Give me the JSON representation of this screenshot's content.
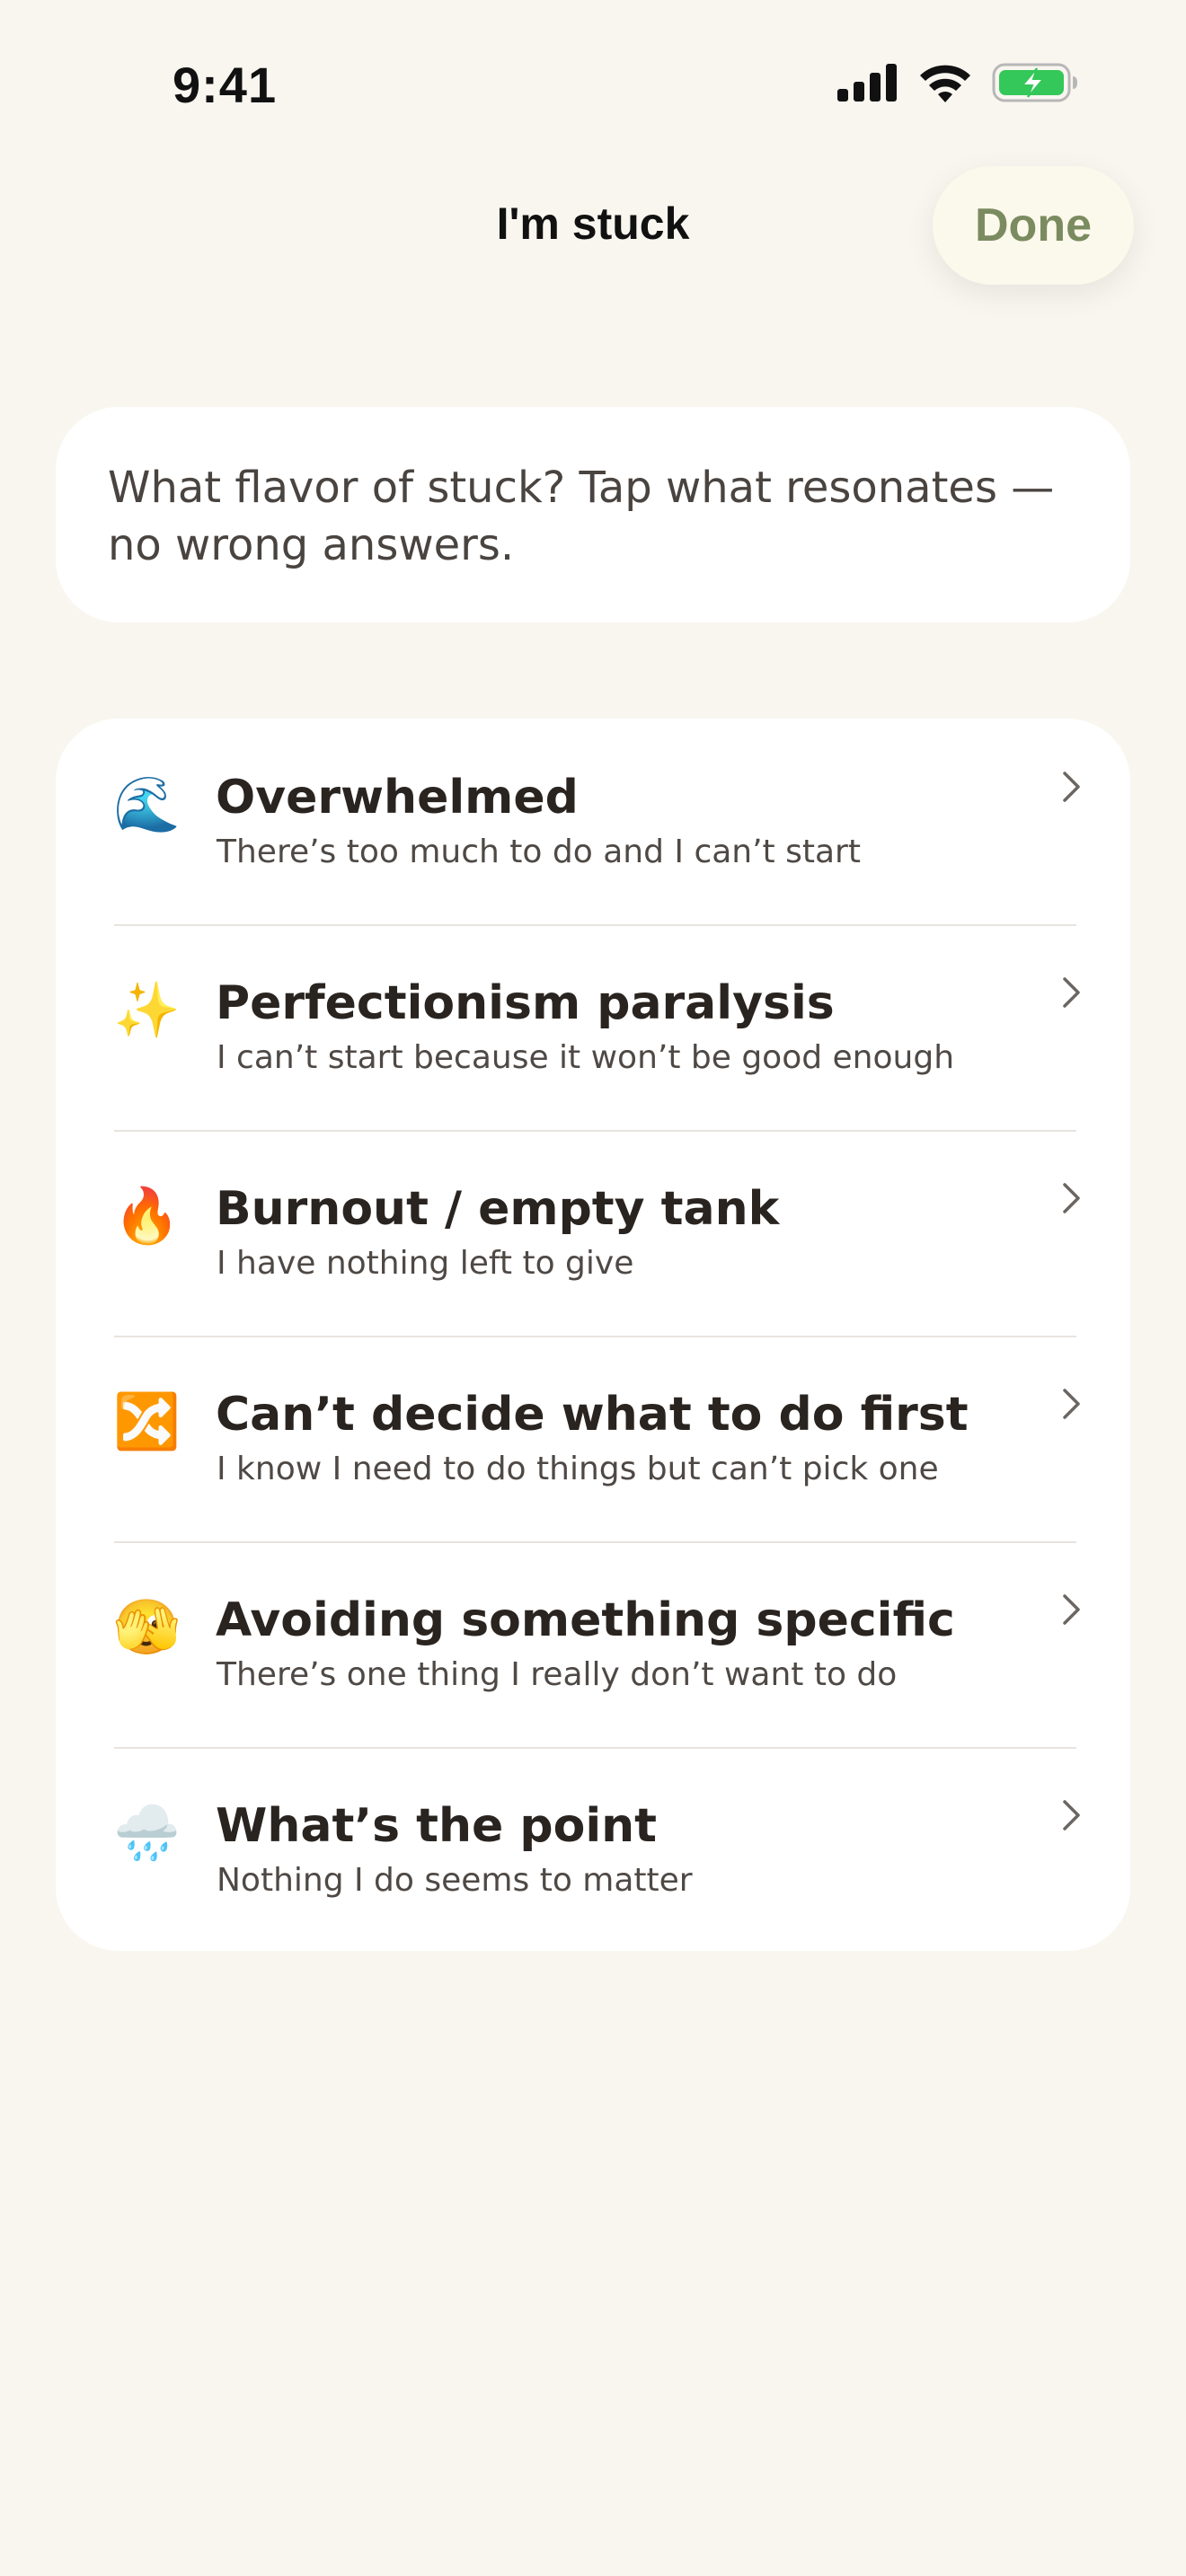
{
  "status_bar": {
    "time": "9:41",
    "icons": [
      "cellular-signal-icon",
      "wifi-icon",
      "battery-charging-icon"
    ]
  },
  "nav": {
    "title": "I'm stuck",
    "done_label": "Done"
  },
  "prompt": {
    "text": "What flavor of stuck? Tap what resonates — no wrong answers."
  },
  "options": [
    {
      "emoji": "🌊",
      "icon": "wave-icon",
      "title": "Overwhelmed",
      "subtitle": "There’s too much to do and I can’t start"
    },
    {
      "emoji": "✨",
      "icon": "sparkles-icon",
      "title": "Perfectionism paralysis",
      "subtitle": "I can’t start because it won’t be good enough"
    },
    {
      "emoji": "🔥",
      "icon": "fire-icon",
      "title": "Burnout / empty tank",
      "subtitle": "I have nothing left to give"
    },
    {
      "emoji": "🔀",
      "icon": "shuffle-icon",
      "title": "Can’t decide what to do first",
      "subtitle": "I know I need to do things but can’t pick one"
    },
    {
      "emoji": "🫣",
      "icon": "peeking-face-icon",
      "title": "Avoiding something specific",
      "subtitle": "There’s one thing I really don’t want to do"
    },
    {
      "emoji": "🌧️",
      "icon": "rain-cloud-icon",
      "title": "What’s the point",
      "subtitle": "Nothing I do seems to matter"
    }
  ],
  "colors": {
    "background": "#f9f6f0",
    "card": "#ffffff",
    "accent": "#7b8b60",
    "battery": "#34c759"
  }
}
